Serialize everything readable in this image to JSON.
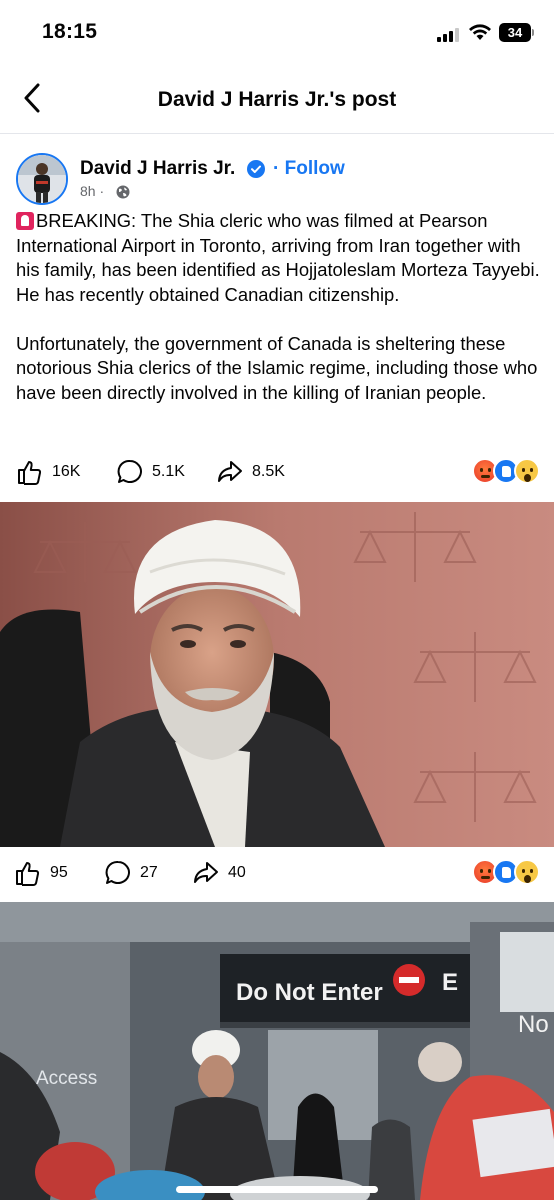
{
  "status": {
    "time": "18:15",
    "battery": "34"
  },
  "header": {
    "title": "David J Harris Jr.'s post",
    "back_icon": "chevron-left-icon"
  },
  "post": {
    "author": "David J Harris Jr.",
    "follow_label": "Follow",
    "separator": "·",
    "time": "8h ·",
    "paragraphs": [
      "BREAKING: The Shia cleric who was filmed at Pearson International Airport in Toronto, arriving from Iran together with his family, has been identified as Hojjatoleslam Morteza Tayyebi. He has recently obtained Canadian citizenship.",
      "Unfortunately, the government of Canada is sheltering these notorious Shia clerics of the Islamic regime, including those who have been directly involved in the killing of Iranian people."
    ],
    "stats": {
      "likes": "16K",
      "comments": "5.1K",
      "shares": "8.5K"
    }
  },
  "media_items": [
    {
      "stats": {
        "likes": "95",
        "comments": "27",
        "shares": "40"
      }
    },
    {
      "signs": {
        "do_not_enter": "Do Not Enter",
        "letter_e": "E",
        "no": "No",
        "access": "Access"
      }
    }
  ],
  "colors": {
    "accent": "#1877f2",
    "text": "#050505",
    "muted": "#65676b",
    "divider": "#e4e6eb"
  }
}
